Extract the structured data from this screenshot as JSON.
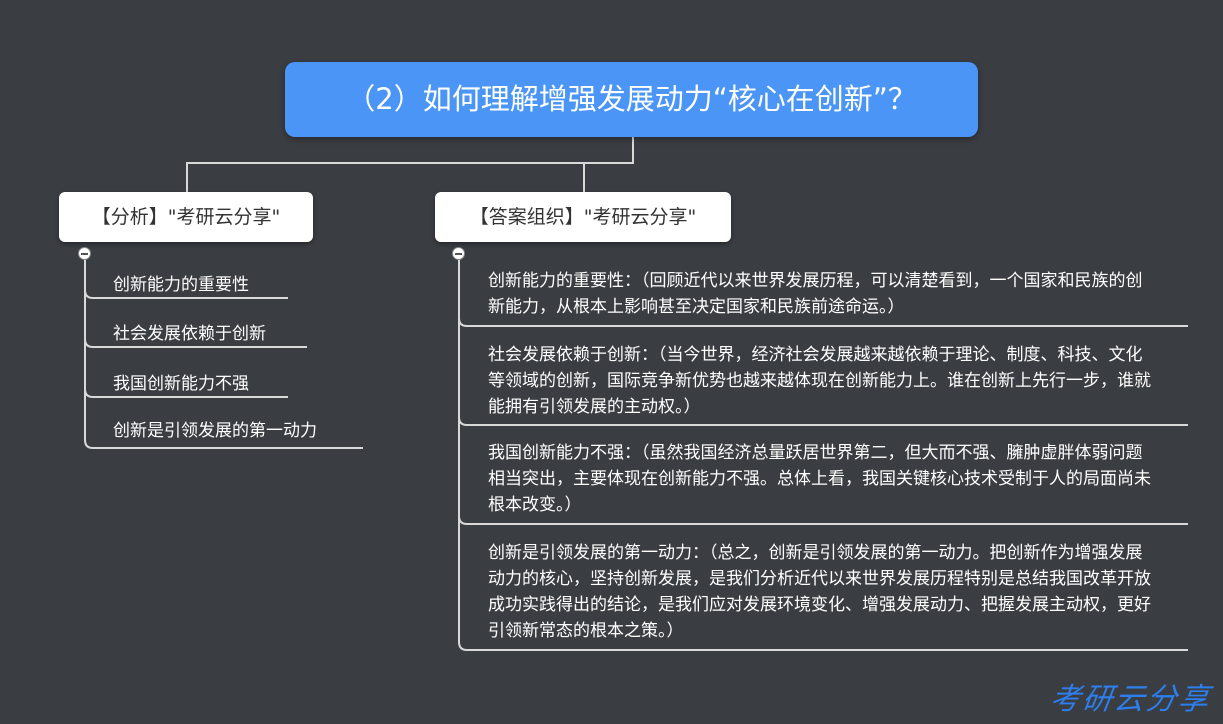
{
  "root": {
    "title": "（2）如何理解增强发展动力“核心在创新”？"
  },
  "branches": [
    {
      "label": "【分析】\"考研云分享\"",
      "items": [
        "创新能力的重要性",
        "社会发展依赖于创新",
        "我国创新能力不强",
        "创新是引领发展的第一动力"
      ]
    },
    {
      "label": "【答案组织】\"考研云分享\"",
      "items": [
        "创新能力的重要性：（回顾近代以来世界发展历程，可以清楚看到，一个国家和民族的创新能力，从根本上影响甚至决定国家和民族前途命运。）",
        "社会发展依赖于创新：（当今世界，经济社会发展越来越依赖于理论、制度、科技、文化等领域的创新，国际竞争新优势也越来越体现在创新能力上。谁在创新上先行一步，谁就能拥有引领发展的主动权。）",
        "我国创新能力不强：（虽然我国经济总量跃居世界第二，但大而不强、臃肿虚胖体弱问题相当突出，主要体现在创新能力不强。总体上看，我国关键核心技术受制于人的局面尚未根本改变。）",
        "创新是引领发展的第一动力：（总之，创新是引领发展的第一动力。把创新作为增强发展动力的核心，坚持创新发展，是我们分析近代以来世界发展历程特别是总结我国改革开放成功实践得出的结论，是我们应对发展环境变化、增强发展动力、把握发展主动权，更好引领新常态的根本之策。）"
      ]
    }
  ],
  "watermark": "考研云分享",
  "colors": {
    "background": "#3a3d42",
    "root": "#4a95f6",
    "line": "#d9d9d9",
    "branch": "#ffffff"
  }
}
